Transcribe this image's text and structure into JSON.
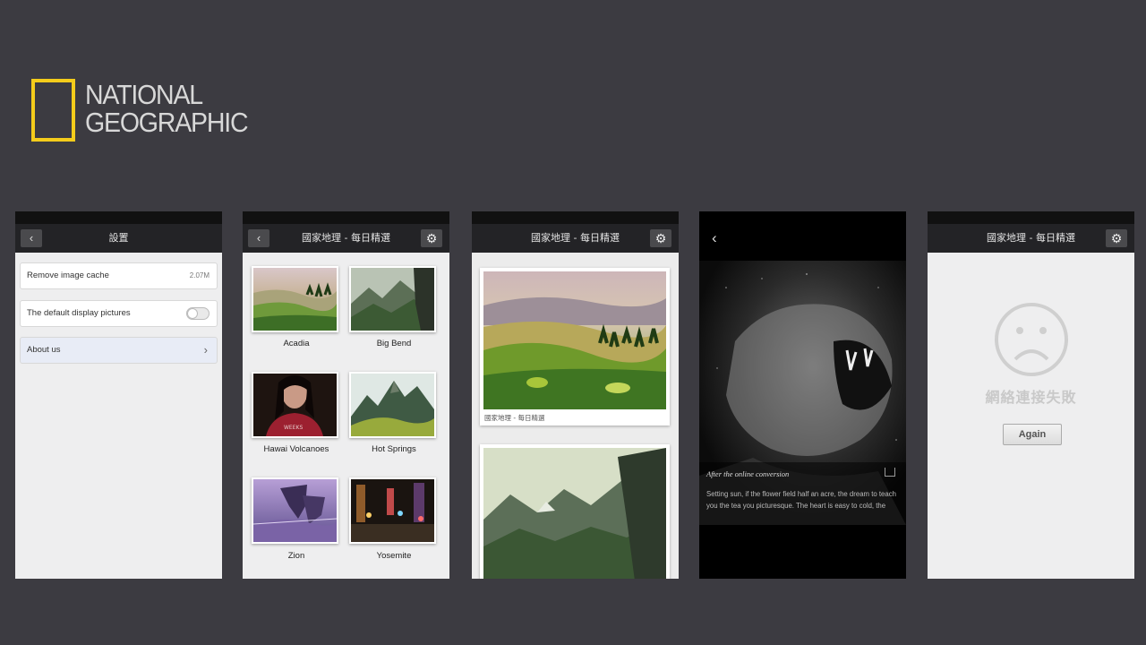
{
  "brand": {
    "line1": "NATIONAL",
    "line2": "GEOGRAPHIC",
    "accent": "#f4cc1b"
  },
  "screen_settings": {
    "title": "設置",
    "back_icon": "chevron-left-icon",
    "rows": {
      "cache_label": "Remove image cache",
      "cache_size": "2.07M",
      "display_label": "The default display pictures",
      "display_toggle_on": false,
      "about_label": "About us"
    }
  },
  "screen_grid": {
    "title": "國家地理 - 每日精選",
    "items": [
      {
        "label": "Acadia"
      },
      {
        "label": "Big Bend"
      },
      {
        "label": "Hawai Volcanoes"
      },
      {
        "label": "Hot Springs"
      },
      {
        "label": "Zion"
      },
      {
        "label": "Yosemite"
      }
    ]
  },
  "screen_feed": {
    "title": "國家地理 - 每日精選",
    "card_caption": "國家地理 - 每日精選"
  },
  "screen_detail": {
    "caption_title": "After the online conversion",
    "caption_body": "Setting sun, if the flower field half an acre, the dream to teach you the tea you picturesque. The heart is easy to cold, the"
  },
  "screen_error": {
    "title": "國家地理 - 每日精選",
    "message": "網絡連接失敗",
    "retry_label": "Again"
  }
}
